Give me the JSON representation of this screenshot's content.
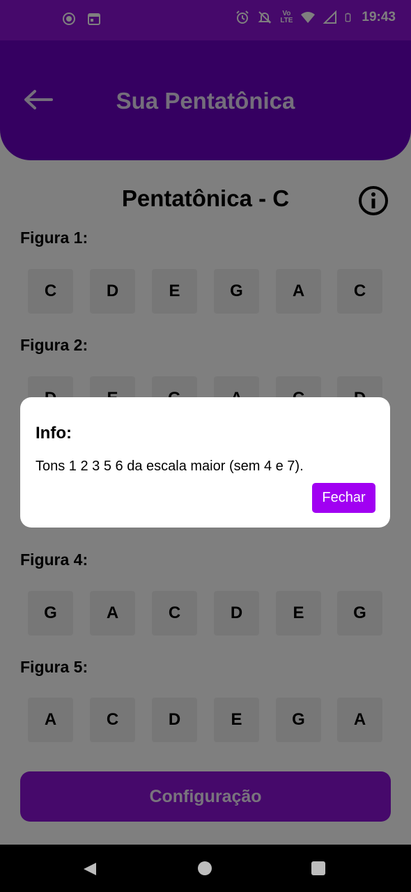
{
  "status_bar": {
    "time": "19:43",
    "network_label": "Vo LTE"
  },
  "app_bar": {
    "title": "Sua Pentatônica"
  },
  "scale": {
    "title": "Pentatônica - C"
  },
  "figures": [
    {
      "label": "Figura 1:",
      "notes": [
        "C",
        "D",
        "E",
        "G",
        "A",
        "C"
      ]
    },
    {
      "label": "Figura 2:",
      "notes": [
        "D",
        "E",
        "G",
        "A",
        "C",
        "D"
      ]
    },
    {
      "label": "Figura 4:",
      "notes": [
        "G",
        "A",
        "C",
        "D",
        "E",
        "G"
      ]
    },
    {
      "label": "Figura 5:",
      "notes": [
        "A",
        "C",
        "D",
        "E",
        "G",
        "A"
      ]
    }
  ],
  "config_button": {
    "label": "Configuração"
  },
  "dialog": {
    "title": "Info:",
    "text": "Tons 1 2 3 5 6 da escala maior (sem 4 e 7).",
    "close_label": "Fechar"
  },
  "colors": {
    "primary": "#8c13d6",
    "app_bar": "#6a00c2",
    "dialog_button": "#a100f2"
  },
  "icons": [
    "screen-record-icon",
    "calendar-icon",
    "alarm-icon",
    "notifications-off-icon",
    "wifi-icon",
    "signal-icon",
    "battery-icon",
    "back-arrow-icon",
    "info-icon"
  ]
}
